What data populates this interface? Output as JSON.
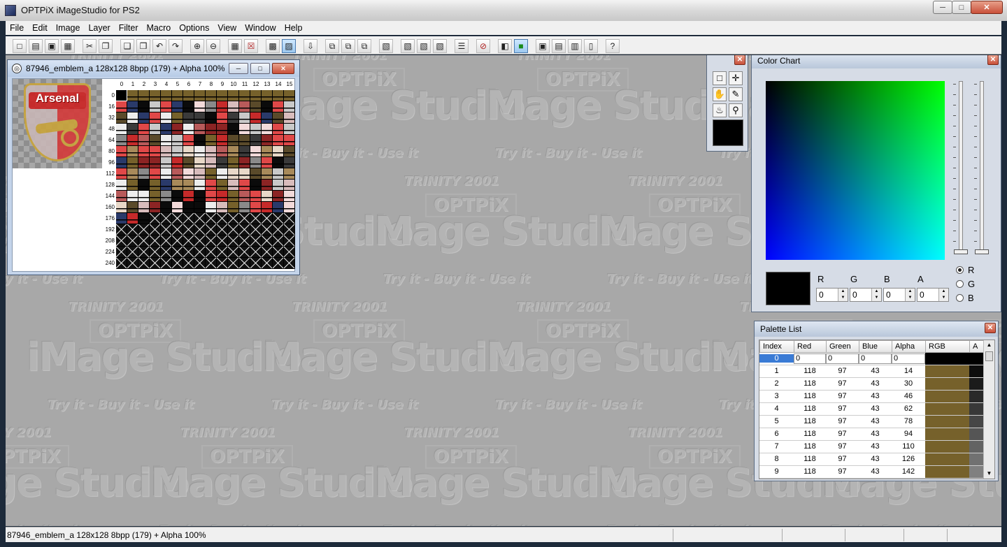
{
  "app": {
    "title": "OPTPiX iMageStudio for PS2"
  },
  "menu": [
    "File",
    "Edit",
    "Image",
    "Layer",
    "Filter",
    "Macro",
    "Options",
    "View",
    "Window",
    "Help"
  ],
  "toolbar": [
    "new-icon",
    "open-icon",
    "save-icon",
    "save-all-icon",
    "cut-icon",
    "copy-icon",
    "paste-icon",
    "paste-special-icon",
    "undo-icon",
    "redo-icon",
    "zoom-in-icon",
    "zoom-out-icon",
    "grid-icon",
    "grid-off-icon",
    "palette-add-icon",
    "palette-grid-icon",
    "import-icon",
    "merge-icon",
    "merge2-icon",
    "merge3-icon",
    "layer1-icon",
    "layer2-icon",
    "layer3-icon",
    "layer4-icon",
    "stack-icon",
    "stop-icon",
    "compare-icon",
    "green-icon",
    "view1-icon",
    "view2-icon",
    "view3-icon",
    "device-icon",
    "help-icon"
  ],
  "watermark": {
    "brand": "OPTPiX",
    "product": "iMage Studio",
    "year": "TRINITY 2001",
    "slogan": "Try it - Buy it - Use it"
  },
  "document": {
    "title": "87946_emblem_a  128x128  8bpp (179) + Alpha  100%",
    "preview_text": "Arsenal",
    "columns": [
      "0",
      "1",
      "2",
      "3",
      "4",
      "5",
      "6",
      "7",
      "8",
      "9",
      "10",
      "11",
      "12",
      "13",
      "14",
      "15"
    ],
    "rows": [
      "0",
      "16",
      "32",
      "48",
      "64",
      "80",
      "96",
      "112",
      "128",
      "144",
      "160",
      "176",
      "192",
      "208",
      "224",
      "240"
    ],
    "used_colors": 179
  },
  "tools": [
    "select-rect-icon",
    "move-icon",
    "hand-icon",
    "pencil-icon",
    "fill-icon",
    "zoom-icon"
  ],
  "color_chart": {
    "title": "Color Chart",
    "labels": [
      "R",
      "G",
      "B",
      "A"
    ],
    "values": [
      "0",
      "0",
      "0",
      "0"
    ],
    "radio": [
      "R",
      "G",
      "B"
    ],
    "selected_radio": "R"
  },
  "palette_list": {
    "title": "Palette List",
    "headers": [
      "Index",
      "Red",
      "Green",
      "Blue",
      "Alpha",
      "RGB",
      "A"
    ],
    "rows": [
      {
        "index": "0",
        "red": "0",
        "green": "0",
        "blue": "0",
        "alpha": "0"
      },
      {
        "index": "1",
        "red": "118",
        "green": "97",
        "blue": "43",
        "alpha": "14"
      },
      {
        "index": "2",
        "red": "118",
        "green": "97",
        "blue": "43",
        "alpha": "30"
      },
      {
        "index": "3",
        "red": "118",
        "green": "97",
        "blue": "43",
        "alpha": "46"
      },
      {
        "index": "4",
        "red": "118",
        "green": "97",
        "blue": "43",
        "alpha": "62"
      },
      {
        "index": "5",
        "red": "118",
        "green": "97",
        "blue": "43",
        "alpha": "78"
      },
      {
        "index": "6",
        "red": "118",
        "green": "97",
        "blue": "43",
        "alpha": "94"
      },
      {
        "index": "7",
        "red": "118",
        "green": "97",
        "blue": "43",
        "alpha": "110"
      },
      {
        "index": "8",
        "red": "118",
        "green": "97",
        "blue": "43",
        "alpha": "126"
      },
      {
        "index": "9",
        "red": "118",
        "green": "97",
        "blue": "43",
        "alpha": "142"
      }
    ]
  },
  "status": {
    "text": "87946_emblem_a  128x128  8bpp (179) + Alpha  100%"
  },
  "colors": {
    "workspace": "#a8a8a8",
    "swatch_brown": "#76612b",
    "selection": "#3a7bd5"
  }
}
